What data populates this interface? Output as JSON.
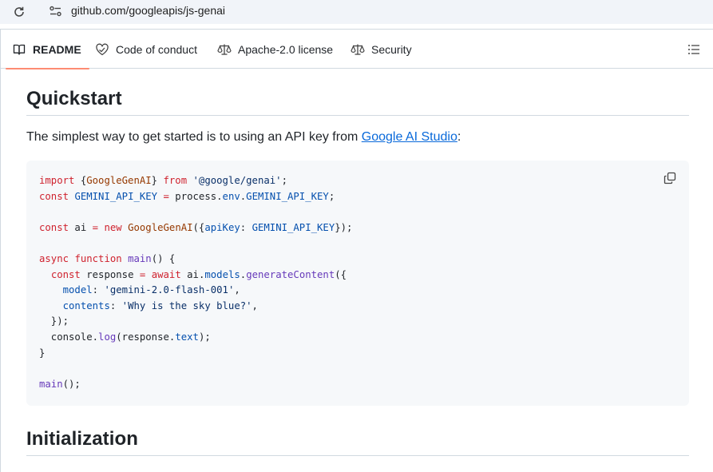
{
  "browser": {
    "url": "github.com/googleapis/js-genai"
  },
  "tabs": [
    {
      "label": "README",
      "icon": "book-icon",
      "active": true
    },
    {
      "label": "Code of conduct",
      "icon": "code-of-conduct-icon"
    },
    {
      "label": "Apache-2.0 license",
      "icon": "law-scale-icon"
    },
    {
      "label": "Security",
      "icon": "law-scale-icon"
    }
  ],
  "readme": {
    "quickstart_heading": "Quickstart",
    "intro_text": "The simplest way to get started is to using an API key from ",
    "intro_link": "Google AI Studio",
    "intro_suffix": ":",
    "code_lines": [
      "import {GoogleGenAI} from '@google/genai';",
      "const GEMINI_API_KEY = process.env.GEMINI_API_KEY;",
      "",
      "const ai = new GoogleGenAI({apiKey: GEMINI_API_KEY});",
      "",
      "async function main() {",
      "  const response = await ai.models.generateContent({",
      "    model: 'gemini-2.0-flash-001',",
      "    contents: 'Why is the sky blue?',",
      "  });",
      "  console.log(response.text);",
      "}",
      "",
      "main();"
    ],
    "initialization_heading": "Initialization"
  },
  "colors": {
    "active_tab_underline": "#fd8c73",
    "link": "#0969da",
    "code_bg": "#f6f8fa"
  }
}
